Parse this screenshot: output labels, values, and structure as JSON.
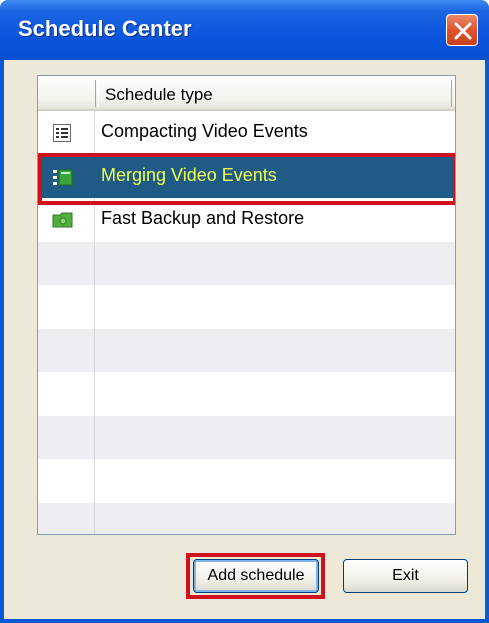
{
  "window": {
    "title": "Schedule Center",
    "close_icon": "close-icon"
  },
  "list": {
    "column_header": "Schedule type",
    "items": [
      {
        "label": "Compacting Video Events",
        "icon": "list-document-icon"
      },
      {
        "label": "Merging Video Events",
        "icon": "merge-list-icon",
        "selected": true
      },
      {
        "label": "Fast Backup and Restore",
        "icon": "green-folder-icon"
      }
    ],
    "empty_rows": 7
  },
  "buttons": {
    "add_label": "Add schedule",
    "exit_label": "Exit"
  },
  "colors": {
    "title_bar": "#0a55dc",
    "selection_bg": "#1f5b84",
    "selection_text": "#f0ff55",
    "highlight_outline": "#d0101c"
  }
}
